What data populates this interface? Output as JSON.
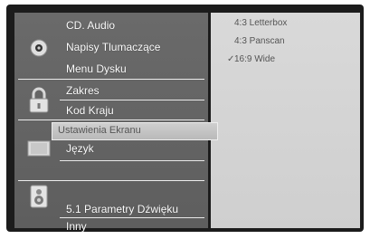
{
  "menu": {
    "items": [
      {
        "label": "CD. Audio"
      },
      {
        "label": "Napisy Tlumaczące"
      },
      {
        "label": "Menu Dysku"
      },
      {
        "label": "Zakres"
      },
      {
        "label": "Kod Kraju"
      },
      {
        "label": "Ustawienia Ekranu"
      },
      {
        "label": "Język"
      },
      {
        "label": "5.1 Parametry Dźwięku"
      },
      {
        "label": "Inny"
      }
    ],
    "selected_index": 5
  },
  "options": [
    {
      "label": "4:3  Letterbox",
      "checked": false
    },
    {
      "label": "4:3  Panscan",
      "checked": false
    },
    {
      "label": "16:9 Wide",
      "checked": true,
      "mark": "✓"
    }
  ]
}
